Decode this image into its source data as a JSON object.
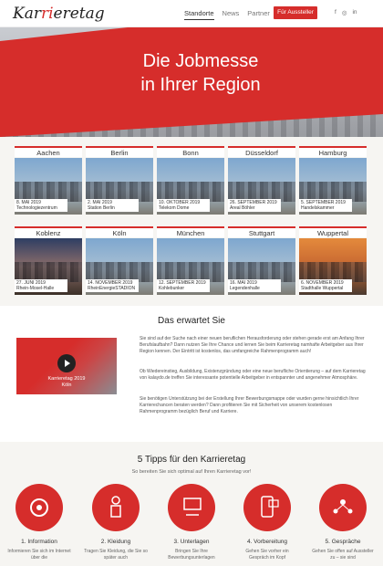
{
  "header": {
    "logo_pre": "Kar",
    "logo_accent": "ri",
    "logo_post": "eretag",
    "nav": [
      "Standorte",
      "News",
      "Partner"
    ],
    "cta": "Für Aussteller",
    "social": [
      "f",
      "◎",
      "in"
    ]
  },
  "hero": {
    "line1": "Die Jobmesse",
    "line2": "in Ihrer Region"
  },
  "cities": [
    {
      "name": "Aachen",
      "date": "8. MAI 2019",
      "venue": "Technologiezentrum"
    },
    {
      "name": "Berlin",
      "date": "2. MAI 2019",
      "venue": "Station Berlin"
    },
    {
      "name": "Bonn",
      "date": "10. OKTOBER 2019",
      "venue": "Telekom Dome"
    },
    {
      "name": "Düsseldorf",
      "date": "26. SEPTEMBER 2019",
      "venue": "Areal Böhler"
    },
    {
      "name": "Hamburg",
      "date": "5. SEPTEMBER 2019",
      "venue": "Handelskammer"
    },
    {
      "name": "Koblenz",
      "date": "27. JUNI 2019",
      "venue": "Rhein-Mosel-Halle"
    },
    {
      "name": "Köln",
      "date": "14. NOVEMBER 2019",
      "venue": "RheinEnergieSTADION"
    },
    {
      "name": "München",
      "date": "12. SEPTEMBER 2019",
      "venue": "Kohlebunker"
    },
    {
      "name": "Stuttgart",
      "date": "16. MAI 2019",
      "venue": "Legendenhalle"
    },
    {
      "name": "Wuppertal",
      "date": "6. NOVEMBER 2019",
      "venue": "Stadthalle Wuppertal"
    }
  ],
  "erwartet": {
    "title": "Das erwartet Sie",
    "video_line1": "Karrieretag 2019",
    "video_line2": "Köln",
    "p1": "Sie sind auf der Suche nach einer neuen beruflichen Herausforderung oder stehen gerade erst am Anfang Ihrer Berufslaufbahn? Dann nutzen Sie Ihre Chance und lernen Sie beim Karrieretag namhafte Arbeitgeber aus Ihrer Region kennen. Der Eintritt ist kostenlos, das umfangreiche Rahmenprogramm auch!",
    "p2": "Ob Wiedereinstieg, Ausbildung, Existenzgründung oder eine neue berufliche Orientierung – auf dem Karrieretag von kalaydo.de treffen Sie interessante potentielle Arbeitgeber in entspannter und angenehmer Atmosphäre.",
    "p3": "Sie benötigen Unterstützung bei der Erstellung Ihrer Bewerbungsmappe oder wurden gerne hinsichtlich Ihrer Karrierechancen beraten werden? Dann profitieren Sie mit Sicherheit von unserem kostenlosen Rahmenprogramm bezüglich Beruf und Karriere."
  },
  "tipps": {
    "title": "5 Tipps für den Karrieretag",
    "subtitle": "So bereiten Sie sich optimal auf Ihren Karrieretag vor!",
    "items": [
      {
        "title": "1. Information",
        "text": "Informieren Sie sich im Internet über die"
      },
      {
        "title": "2. Kleidung",
        "text": "Tragen Sie Kleidung, die Sie so später auch"
      },
      {
        "title": "3. Unterlagen",
        "text": "Bringen Sie Ihre Bewerbungsunterlagen"
      },
      {
        "title": "4. Vorbereitung",
        "text": "Gehen Sie vorher ein Gespräch im Kopf"
      },
      {
        "title": "5. Gespräche",
        "text": "Gehen Sie offen auf Aussteller zu – sie sind"
      }
    ]
  },
  "colors": {
    "accent": "#d62d2b",
    "section_bg": "#f6f5f2"
  },
  "icons": [
    "settings-globe-icon",
    "person-icon",
    "presentation-icon",
    "mobile-chat-icon",
    "network-people-icon"
  ]
}
